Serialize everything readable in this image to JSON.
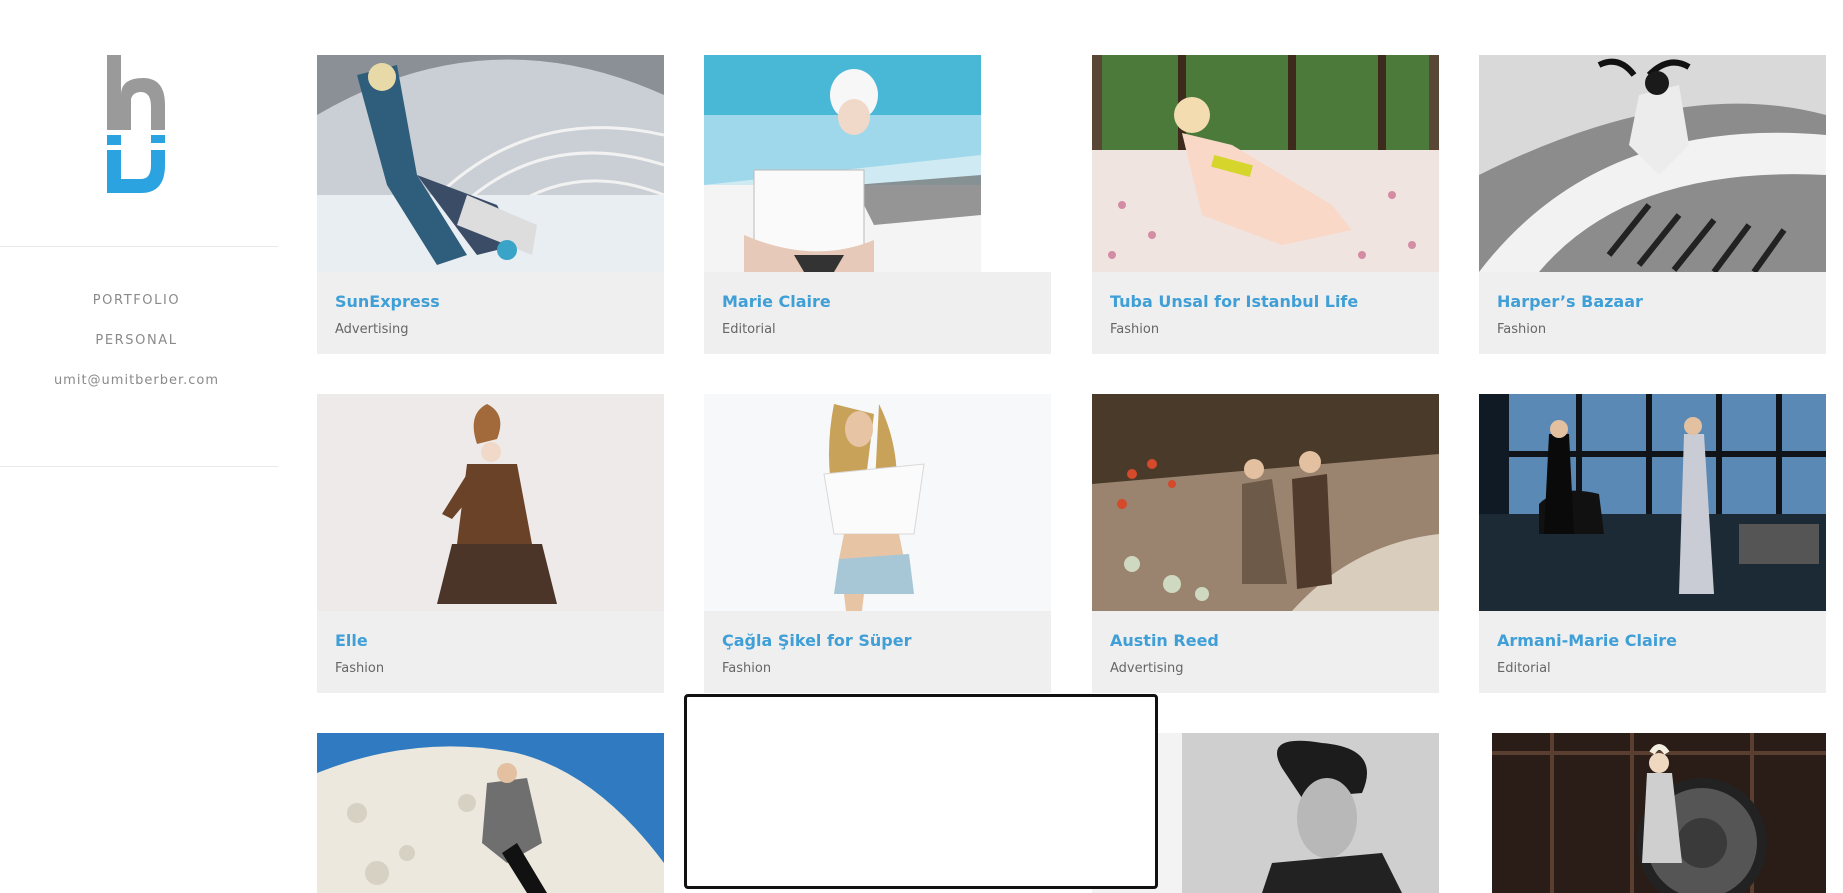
{
  "sidebar": {
    "logo_letter": "b",
    "nav": [
      {
        "label": "PORTFOLIO"
      },
      {
        "label": "PERSONAL"
      },
      {
        "label": "umit@umitberber.com"
      }
    ]
  },
  "projects": [
    {
      "title": "SunExpress",
      "category": "Advertising"
    },
    {
      "title": "Marie Claire",
      "category": "Editorial"
    },
    {
      "title": "Tuba Unsal for Istanbul Life",
      "category": "Fashion"
    },
    {
      "title": "Harper’s Bazaar",
      "category": "Fashion"
    },
    {
      "title": "Elle",
      "category": "Fashion"
    },
    {
      "title": "Çağla Şikel for Süper",
      "category": "Fashion"
    },
    {
      "title": "Austin Reed",
      "category": "Advertising"
    },
    {
      "title": "Armani-Marie Claire",
      "category": "Editorial"
    }
  ],
  "colors": {
    "accent": "#3f9fd6",
    "logo_gray": "#9a9a9a",
    "logo_blue": "#2ba3e0",
    "card_bg": "#efefef"
  }
}
